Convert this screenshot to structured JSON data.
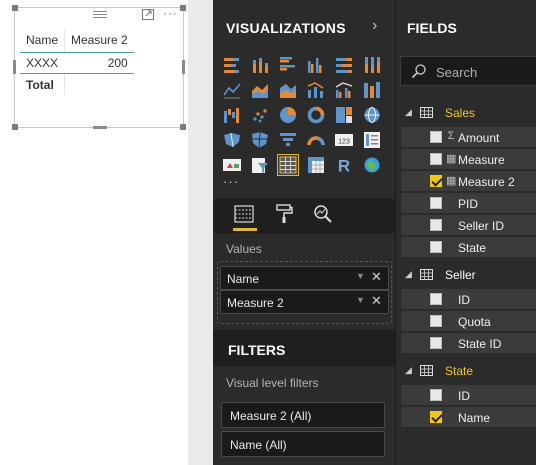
{
  "table_visual": {
    "columns": [
      "Name",
      "Measure 2"
    ],
    "rows": [
      {
        "name": "XXXX",
        "measure2": "200"
      }
    ],
    "total_label": "Total",
    "more_label": "···"
  },
  "visualizations": {
    "title": "VISUALIZATIONS",
    "chevron": "›",
    "more_label": "···",
    "values_label": "Values",
    "value_wells": [
      {
        "label": "Name",
        "dropdown": "▼",
        "remove": "✕"
      },
      {
        "label": "Measure 2",
        "dropdown": "▼",
        "remove": "✕"
      }
    ],
    "icons": [
      "stacked-bar-icon",
      "stacked-column-icon",
      "clustered-bar-icon",
      "clustered-column-icon",
      "100-stacked-bar-icon",
      "100-stacked-column-icon",
      "line-chart-icon",
      "area-chart-icon",
      "stacked-area-icon",
      "line-column-icon",
      "line-clustered-column-icon",
      "ribbon-chart-icon",
      "waterfall-icon",
      "scatter-icon",
      "pie-icon",
      "donut-icon",
      "treemap-icon",
      "globe-map-icon",
      "filled-map-icon",
      "shape-map-icon",
      "funnel-icon",
      "gauge-icon",
      "card-icon",
      "multi-row-card-icon",
      "kpi-icon",
      "slicer-icon",
      "table-icon",
      "matrix-icon",
      "r-visual-icon",
      "arcgis-icon"
    ],
    "selected_icon": "table-icon",
    "r_letter": "R",
    "card_text": "123",
    "accent_color": "#e1b83a"
  },
  "filters": {
    "title": "FILTERS",
    "visual_level_label": "Visual level filters",
    "items": [
      "Measure 2 (All)",
      "Name (All)"
    ]
  },
  "fields": {
    "title": "FIELDS",
    "search_placeholder": "Search",
    "tables": [
      {
        "name": "Sales",
        "name_color": "#f2c811",
        "expand_icon": "◢",
        "fields": [
          {
            "label": "Amount",
            "icon": "sigma-icon",
            "glyph": "Σ",
            "checked": false
          },
          {
            "label": "Measure",
            "icon": "calculator-icon",
            "glyph": "▦",
            "checked": false
          },
          {
            "label": "Measure 2",
            "icon": "calculator-icon",
            "glyph": "▦",
            "checked": true
          },
          {
            "label": "PID",
            "icon": "",
            "glyph": "",
            "checked": false
          },
          {
            "label": "Seller ID",
            "icon": "",
            "glyph": "",
            "checked": false
          },
          {
            "label": "State",
            "icon": "",
            "glyph": "",
            "checked": false
          }
        ]
      },
      {
        "name": "Seller",
        "name_color": "#ffffff",
        "expand_icon": "◢",
        "fields": [
          {
            "label": "ID",
            "icon": "",
            "glyph": "",
            "checked": false
          },
          {
            "label": "Quota",
            "icon": "",
            "glyph": "",
            "checked": false
          },
          {
            "label": "State ID",
            "icon": "",
            "glyph": "",
            "checked": false
          }
        ]
      },
      {
        "name": "State",
        "name_color": "#f2c811",
        "expand_icon": "◢",
        "fields": [
          {
            "label": "ID",
            "icon": "",
            "glyph": "",
            "checked": false
          },
          {
            "label": "Name",
            "icon": "",
            "glyph": "",
            "checked": true
          }
        ]
      }
    ]
  }
}
